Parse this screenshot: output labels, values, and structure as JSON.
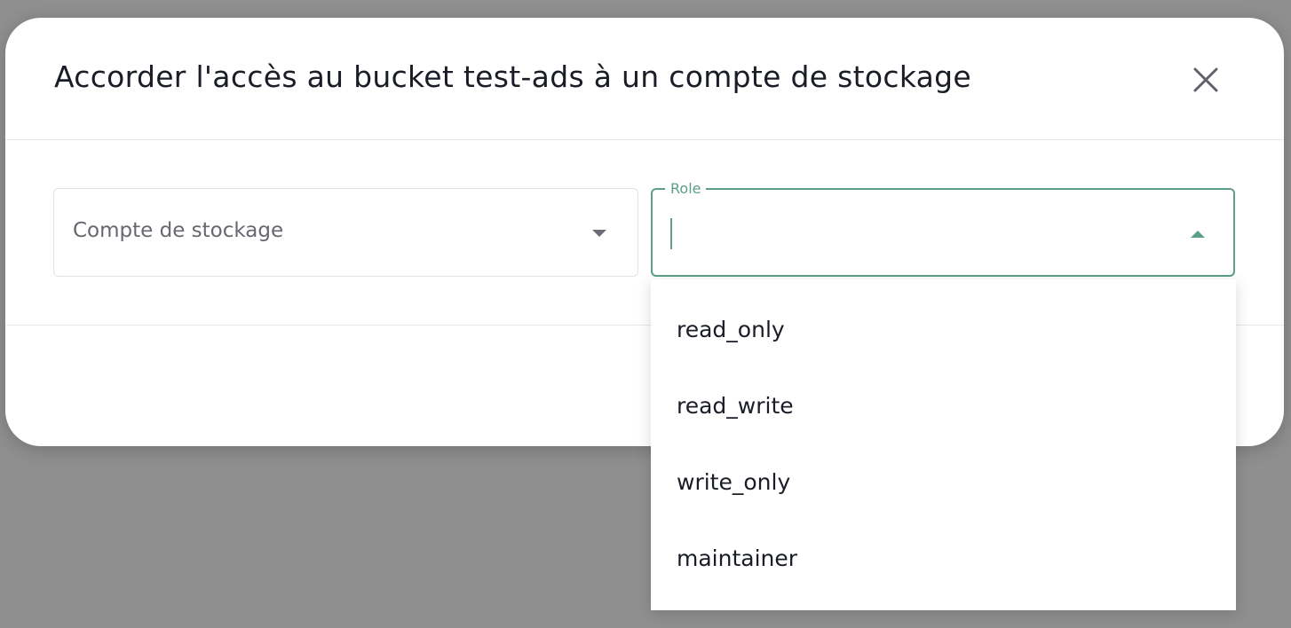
{
  "dialog": {
    "title": "Accorder l'accès au bucket test-ads à un compte de stockage",
    "close_icon": "close-icon"
  },
  "form": {
    "storage_account": {
      "placeholder": "Compte de stockage",
      "value": ""
    },
    "role": {
      "label": "Role",
      "value": ""
    }
  },
  "role_options": [
    "read_only",
    "read_write",
    "write_only",
    "maintainer"
  ],
  "colors": {
    "accent": "#5c9e88",
    "overlay": "#8f8f90"
  }
}
